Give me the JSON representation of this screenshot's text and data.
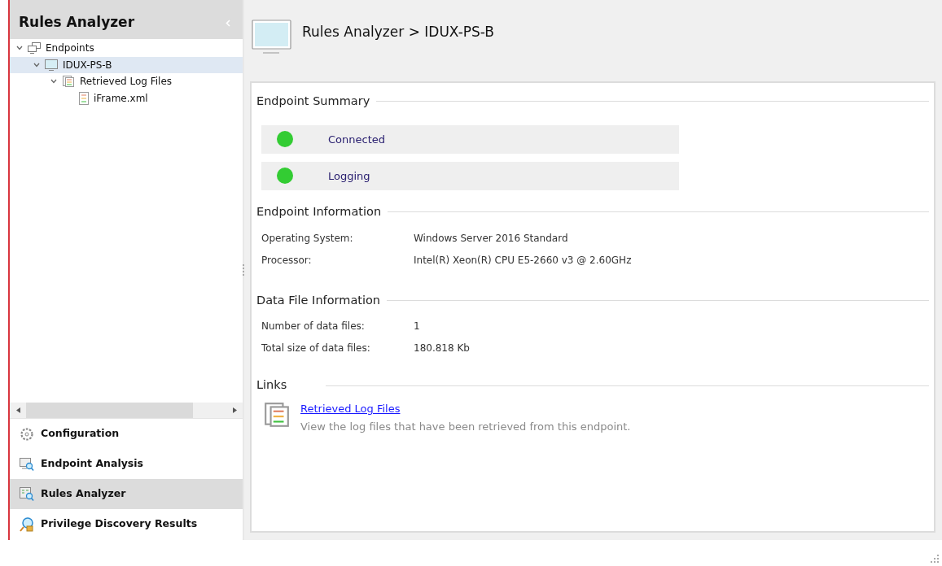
{
  "sidebar": {
    "title": "Rules Analyzer",
    "tree": [
      {
        "label": "Endpoints",
        "kind": "group",
        "expanded": true,
        "selected": false,
        "children": [
          {
            "label": "IDUX-PS-B",
            "kind": "computer",
            "expanded": true,
            "selected": true,
            "children": [
              {
                "label": "Retrieved Log Files",
                "kind": "logs",
                "expanded": true,
                "selected": false,
                "children": [
                  {
                    "label": "iFrame.xml",
                    "kind": "file",
                    "selected": false
                  }
                ]
              }
            ]
          }
        ]
      }
    ],
    "nav": [
      {
        "label": "Configuration",
        "kind": "gear",
        "selected": false
      },
      {
        "label": "Endpoint Analysis",
        "kind": "analysis",
        "selected": false
      },
      {
        "label": "Rules Analyzer",
        "kind": "rules",
        "selected": true
      },
      {
        "label": "Privilege Discovery Results",
        "kind": "privilege",
        "selected": false
      }
    ]
  },
  "header": {
    "title": "Rules Analyzer > IDUX-PS-B"
  },
  "summary": {
    "title": "Endpoint Summary",
    "items": [
      {
        "label": "Connected",
        "color": "#33cc33"
      },
      {
        "label": "Logging",
        "color": "#33cc33"
      }
    ]
  },
  "endpoint_info": {
    "title": "Endpoint Information",
    "rows": [
      {
        "label": "Operating System:",
        "value": "Windows Server 2016 Standard"
      },
      {
        "label": "Processor:",
        "value": "Intel(R) Xeon(R) CPU E5-2660 v3 @ 2.60GHz"
      }
    ]
  },
  "data_file_info": {
    "title": "Data File Information",
    "rows": [
      {
        "label": "Number of data files:",
        "value": "1"
      },
      {
        "label": "Total size of data files:",
        "value": "180.818 Kb"
      }
    ]
  },
  "links": {
    "title": "Links",
    "items": [
      {
        "label": "Retrieved Log Files",
        "description": "View the log files that have been retrieved from this endpoint."
      }
    ]
  }
}
